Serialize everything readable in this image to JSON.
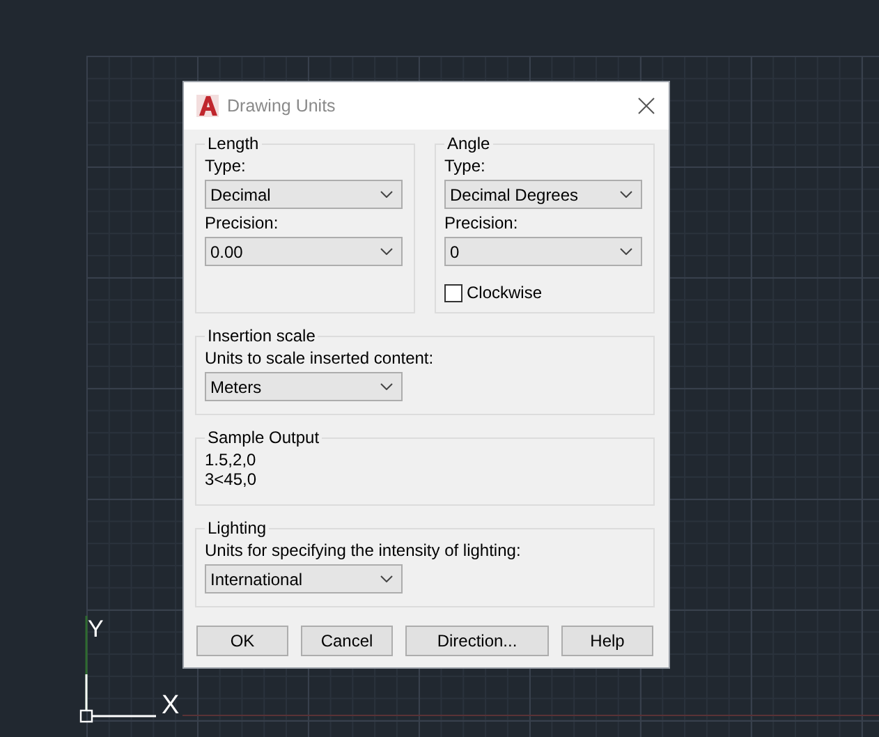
{
  "canvas": {
    "ucs": {
      "y_label": "Y",
      "x_label": "X"
    }
  },
  "window": {
    "title": "Drawing Units"
  },
  "length": {
    "title": "Length",
    "type_label": "Type:",
    "type": "Decimal",
    "precision_label": "Precision:",
    "precision": "0.00"
  },
  "angle": {
    "title": "Angle",
    "type_label": "Type:",
    "type": "Decimal Degrees",
    "precision_label": "Precision:",
    "precision": "0",
    "clockwise": {
      "label": "Clockwise",
      "checked": false
    }
  },
  "insertion_scale": {
    "title": "Insertion scale",
    "label": "Units to scale inserted content:",
    "value": "Meters"
  },
  "sample_output": {
    "title": "Sample Output",
    "lines": [
      "1.5,2,0",
      "3<45,0"
    ]
  },
  "lighting": {
    "title": "Lighting",
    "label": "Units for specifying the intensity of lighting:",
    "value": "International"
  },
  "buttons": [
    "OK",
    "Cancel",
    "Direction...",
    "Help"
  ]
}
